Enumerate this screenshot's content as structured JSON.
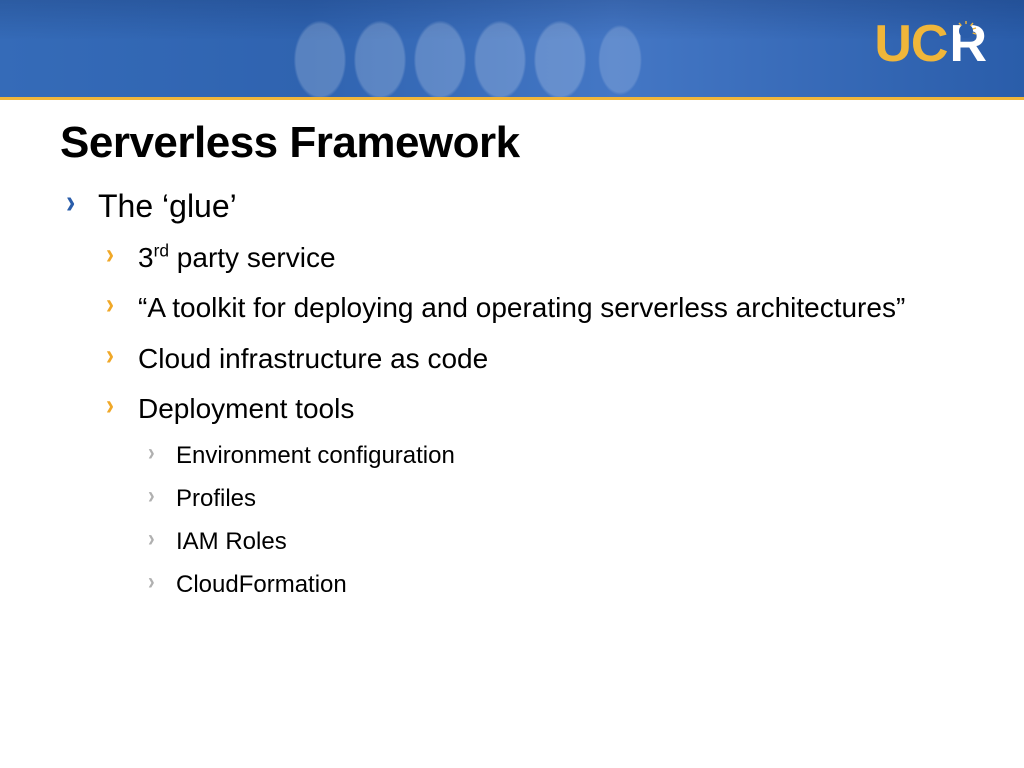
{
  "logo": {
    "uc": "UC",
    "r": "R"
  },
  "title": "Serverless Framework",
  "l1": {
    "item0": "The ‘glue’"
  },
  "l2": {
    "item0_pre": "3",
    "item0_sup": "rd",
    "item0_post": " party service",
    "item1": "“A toolkit for deploying and operating serverless architectures”",
    "item2": "Cloud infrastructure as code",
    "item3": "Deployment tools"
  },
  "l3": {
    "item0": "Environment configuration",
    "item1": "Profiles",
    "item2": "IAM Roles",
    "item3": "CloudFormation"
  }
}
